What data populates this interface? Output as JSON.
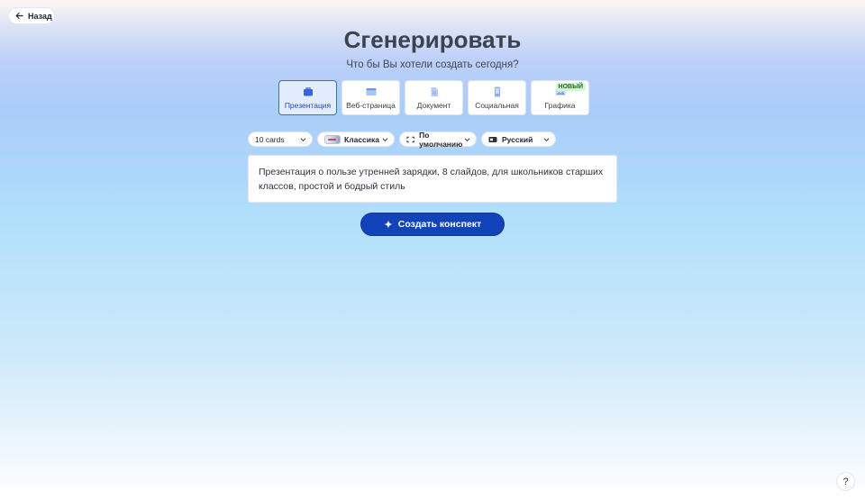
{
  "nav": {
    "back_label": "Назад"
  },
  "header": {
    "title": "Сгенерировать",
    "subtitle": "Что бы Вы хотели создать сегодня?"
  },
  "types": [
    {
      "label": "Презентация",
      "icon": "presentation-icon",
      "active": true
    },
    {
      "label": "Веб-страница",
      "icon": "webpage-icon",
      "active": false
    },
    {
      "label": "Документ",
      "icon": "document-icon",
      "active": false
    },
    {
      "label": "Социальная",
      "icon": "social-icon",
      "active": false
    },
    {
      "label": "Графика",
      "icon": "graphics-icon",
      "active": false,
      "badge": "НОВЫЙ"
    }
  ],
  "options": {
    "cards": "10 cards",
    "theme": "Классика",
    "dimensions": "По умолчанию",
    "language": "Русский"
  },
  "prompt": {
    "value": "Презентация о пользе утренней зарядки, 8 слайдов, для школьников старших классов, простой и бодрый стиль"
  },
  "actions": {
    "generate_label": "Создать конспект"
  },
  "help": {
    "label": "?"
  },
  "colors": {
    "accent": "#1343b9",
    "active_card_bg": "#e3ecfd",
    "badge_bg": "#d6f5d1"
  }
}
